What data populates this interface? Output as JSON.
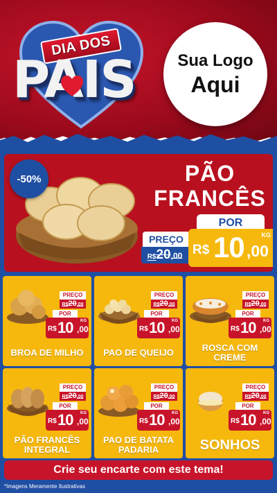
{
  "header": {
    "banner_text": "DIA DOS",
    "title_text": "PAIS",
    "logo_line1": "Sua Logo",
    "logo_line2": "Aqui"
  },
  "featured": {
    "discount": "-50%",
    "name_line1": "PÃO",
    "name_line2": "FRANCÊS",
    "old_label": "PREÇO",
    "old_currency": "R$",
    "old_int": "20",
    "old_dec": ",00",
    "new_label": "POR",
    "new_currency": "R$",
    "new_int": "10",
    "new_dec": ",00",
    "unit": "KG"
  },
  "products": [
    {
      "name": "BROA DE MILHO",
      "preco_label": "PREÇO",
      "old_cur": "R$",
      "old_int": "20",
      "old_dec": ",00",
      "por_label": "POR",
      "cur": "R$",
      "int": "10",
      "dec": ",00",
      "unit": "KG"
    },
    {
      "name": "PAO DE QUEIJO",
      "preco_label": "PREÇO",
      "old_cur": "R$",
      "old_int": "20",
      "old_dec": ",00",
      "por_label": "POR",
      "cur": "R$",
      "int": "10",
      "dec": ",00",
      "unit": "KG"
    },
    {
      "name": "ROSCA COM CREME",
      "preco_label": "PREÇO",
      "old_cur": "R$",
      "old_int": "20",
      "old_dec": ",00",
      "por_label": "POR",
      "cur": "R$",
      "int": "10",
      "dec": ",00",
      "unit": "KG"
    },
    {
      "name": "PÃO FRANCÊS INTEGRAL",
      "preco_label": "PREÇO",
      "old_cur": "R$",
      "old_int": "20",
      "old_dec": ",00",
      "por_label": "POR",
      "cur": "R$",
      "int": "10",
      "dec": ",00",
      "unit": "KG"
    },
    {
      "name": "PAO DE BATATA PADARIA",
      "preco_label": "PREÇO",
      "old_cur": "R$",
      "old_int": "20",
      "old_dec": ",00",
      "por_label": "POR",
      "cur": "R$",
      "int": "10",
      "dec": ",00",
      "unit": "KG"
    },
    {
      "name": "SONHOS",
      "preco_label": "PREÇO",
      "old_cur": "R$",
      "old_int": "20",
      "old_dec": ",00",
      "por_label": "POR",
      "cur": "R$",
      "int": "10",
      "dec": ",00",
      "unit": "KG"
    }
  ],
  "cta": "Crie seu encarte com este tema!",
  "disclaimer": "*Imagens Meramente Ilustrativas",
  "colors": {
    "red": "#c8142a",
    "blue": "#1f4fa3",
    "yellow": "#f6b80d",
    "white": "#ffffff"
  }
}
